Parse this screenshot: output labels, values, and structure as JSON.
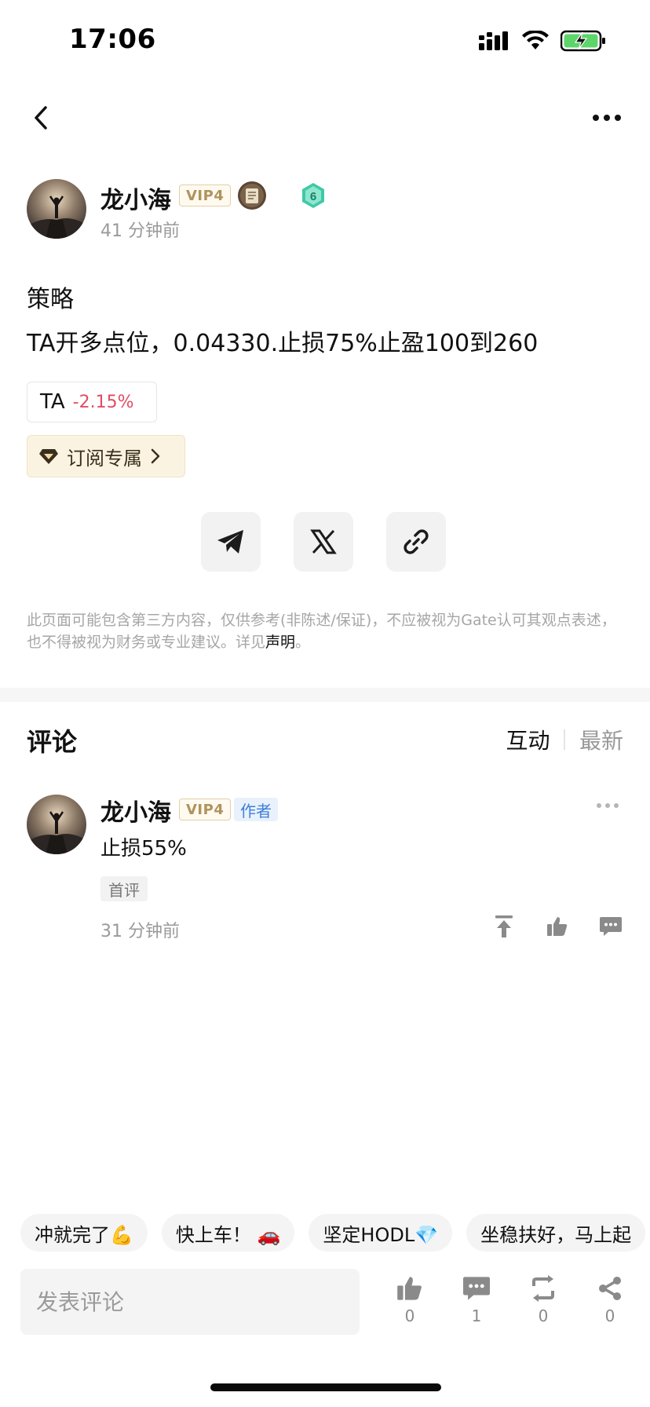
{
  "status_bar": {
    "time": "17:06"
  },
  "post": {
    "author": {
      "name": "龙小海",
      "vip": "VIP4",
      "level": "6",
      "posted": "41 分钟前"
    },
    "title": "策略",
    "body": "TA开多点位，0.04330.止损75%止盈100到260",
    "ticker": {
      "symbol": "TA",
      "change": "-2.15%"
    },
    "subscription": {
      "label": "订阅专属"
    },
    "disclaimer": {
      "text": "此页面可能包含第三方内容，仅供参考(非陈述/保证)，不应被视为Gate认可其观点表述，也不得被视为财务或专业建议。详见",
      "link": "声明",
      "suffix": "。"
    }
  },
  "comments": {
    "title": "评论",
    "tabs": [
      "互动",
      "最新"
    ],
    "active_tab": "互动",
    "items": [
      {
        "name": "龙小海",
        "vip": "VIP4",
        "tag": "作者",
        "text": "止损55%",
        "badge": "首评",
        "time": "31 分钟前"
      }
    ]
  },
  "quick_replies": [
    "冲就完了💪",
    "快上车！ 🚗",
    "坚定HODL💎",
    "坐稳扶好，马上起"
  ],
  "bottom_bar": {
    "input_placeholder": "发表评论",
    "like_count": "0",
    "comment_count": "1",
    "repost_count": "0",
    "share_count": "0"
  },
  "colors": {
    "negative": "#e14c63",
    "vip_gold": "#b0935c",
    "author_tag_blue": "#3e7fd8",
    "level_badge": "#3fc9a8"
  },
  "icons": [
    "back-icon",
    "more-icon",
    "telegram-icon",
    "x-icon",
    "link-icon",
    "pin-icon",
    "thumbs-up-icon",
    "comment-icon",
    "repost-icon",
    "share-icon",
    "diamond-icon",
    "chevron-right-icon"
  ]
}
